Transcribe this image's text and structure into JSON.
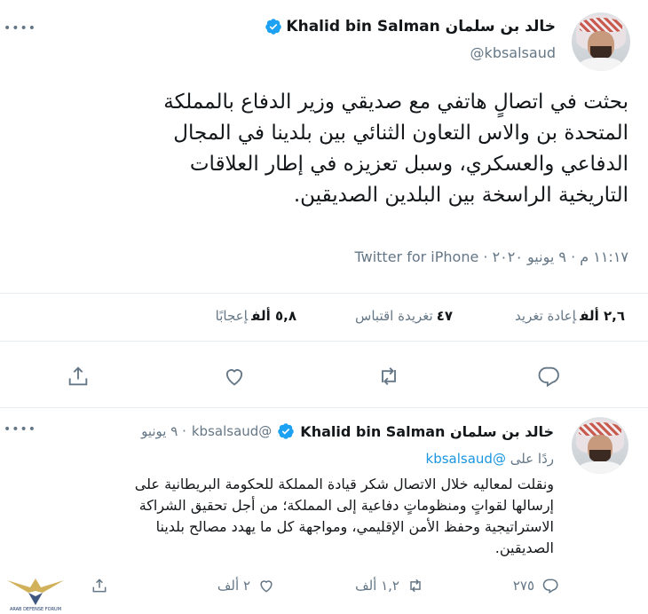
{
  "main": {
    "author_name": "خالد بن سلمان Khalid bin Salman",
    "handle": "@kbsalsaud",
    "text_lines": [
      "بحثت في اتصالٍ هاتفي مع صديقي وزير الدفاع بالمملكة",
      "المتحدة بن والاس التعاون الثنائي بين بلدينا في المجال",
      "الدفاعي والعسكري، وسبل تعزيزه في إطار العلاقات",
      "التاريخية الراسخة بين البلدين الصديقين."
    ],
    "meta": "١١:١٧ م · ٩ يونيو ٢٠٢٠ · Twitter for iPhone",
    "stats": {
      "retweets_count": "٢,٦ ألف",
      "retweets_label": "إعادة تغريد",
      "quotes_count": "٤٧",
      "quotes_label": "تغريدة اقتباس",
      "likes_count": "٥,٨ ألف",
      "likes_label": "إعجابًا"
    }
  },
  "reply": {
    "author_name": "خالد بن سلمان Khalid bin Salman",
    "handle": "@kbsalsaud",
    "date": "· ٩ يونيو",
    "replying_prefix": "ردًا على",
    "replying_mention": "@kbsalsaud",
    "text_lines": [
      "ونقلت لمعاليه خلال الاتصال شكر قيادة المملكة للحكومة البريطانية على",
      "إرسالها لقواتٍ ومنظوماتٍ دفاعية إلى المملكة؛ من أجل تحقيق الشراكة",
      "الاستراتيجية وحفظ الأمن الإقليمي، ومواجهة كل ما يهدد مصالح بلدينا",
      "الصديقين."
    ],
    "reply_count": "٢٧٥",
    "retweet_count": "١,٢ ألف",
    "like_count": "٢ ألف"
  },
  "watermark_text": "ARAB DEFENSE FORUM",
  "colors": {
    "verified": "#1da1f2",
    "link": "#1b95e0",
    "muted": "#657786",
    "text": "#14171a",
    "divider": "#e6ecf0"
  }
}
